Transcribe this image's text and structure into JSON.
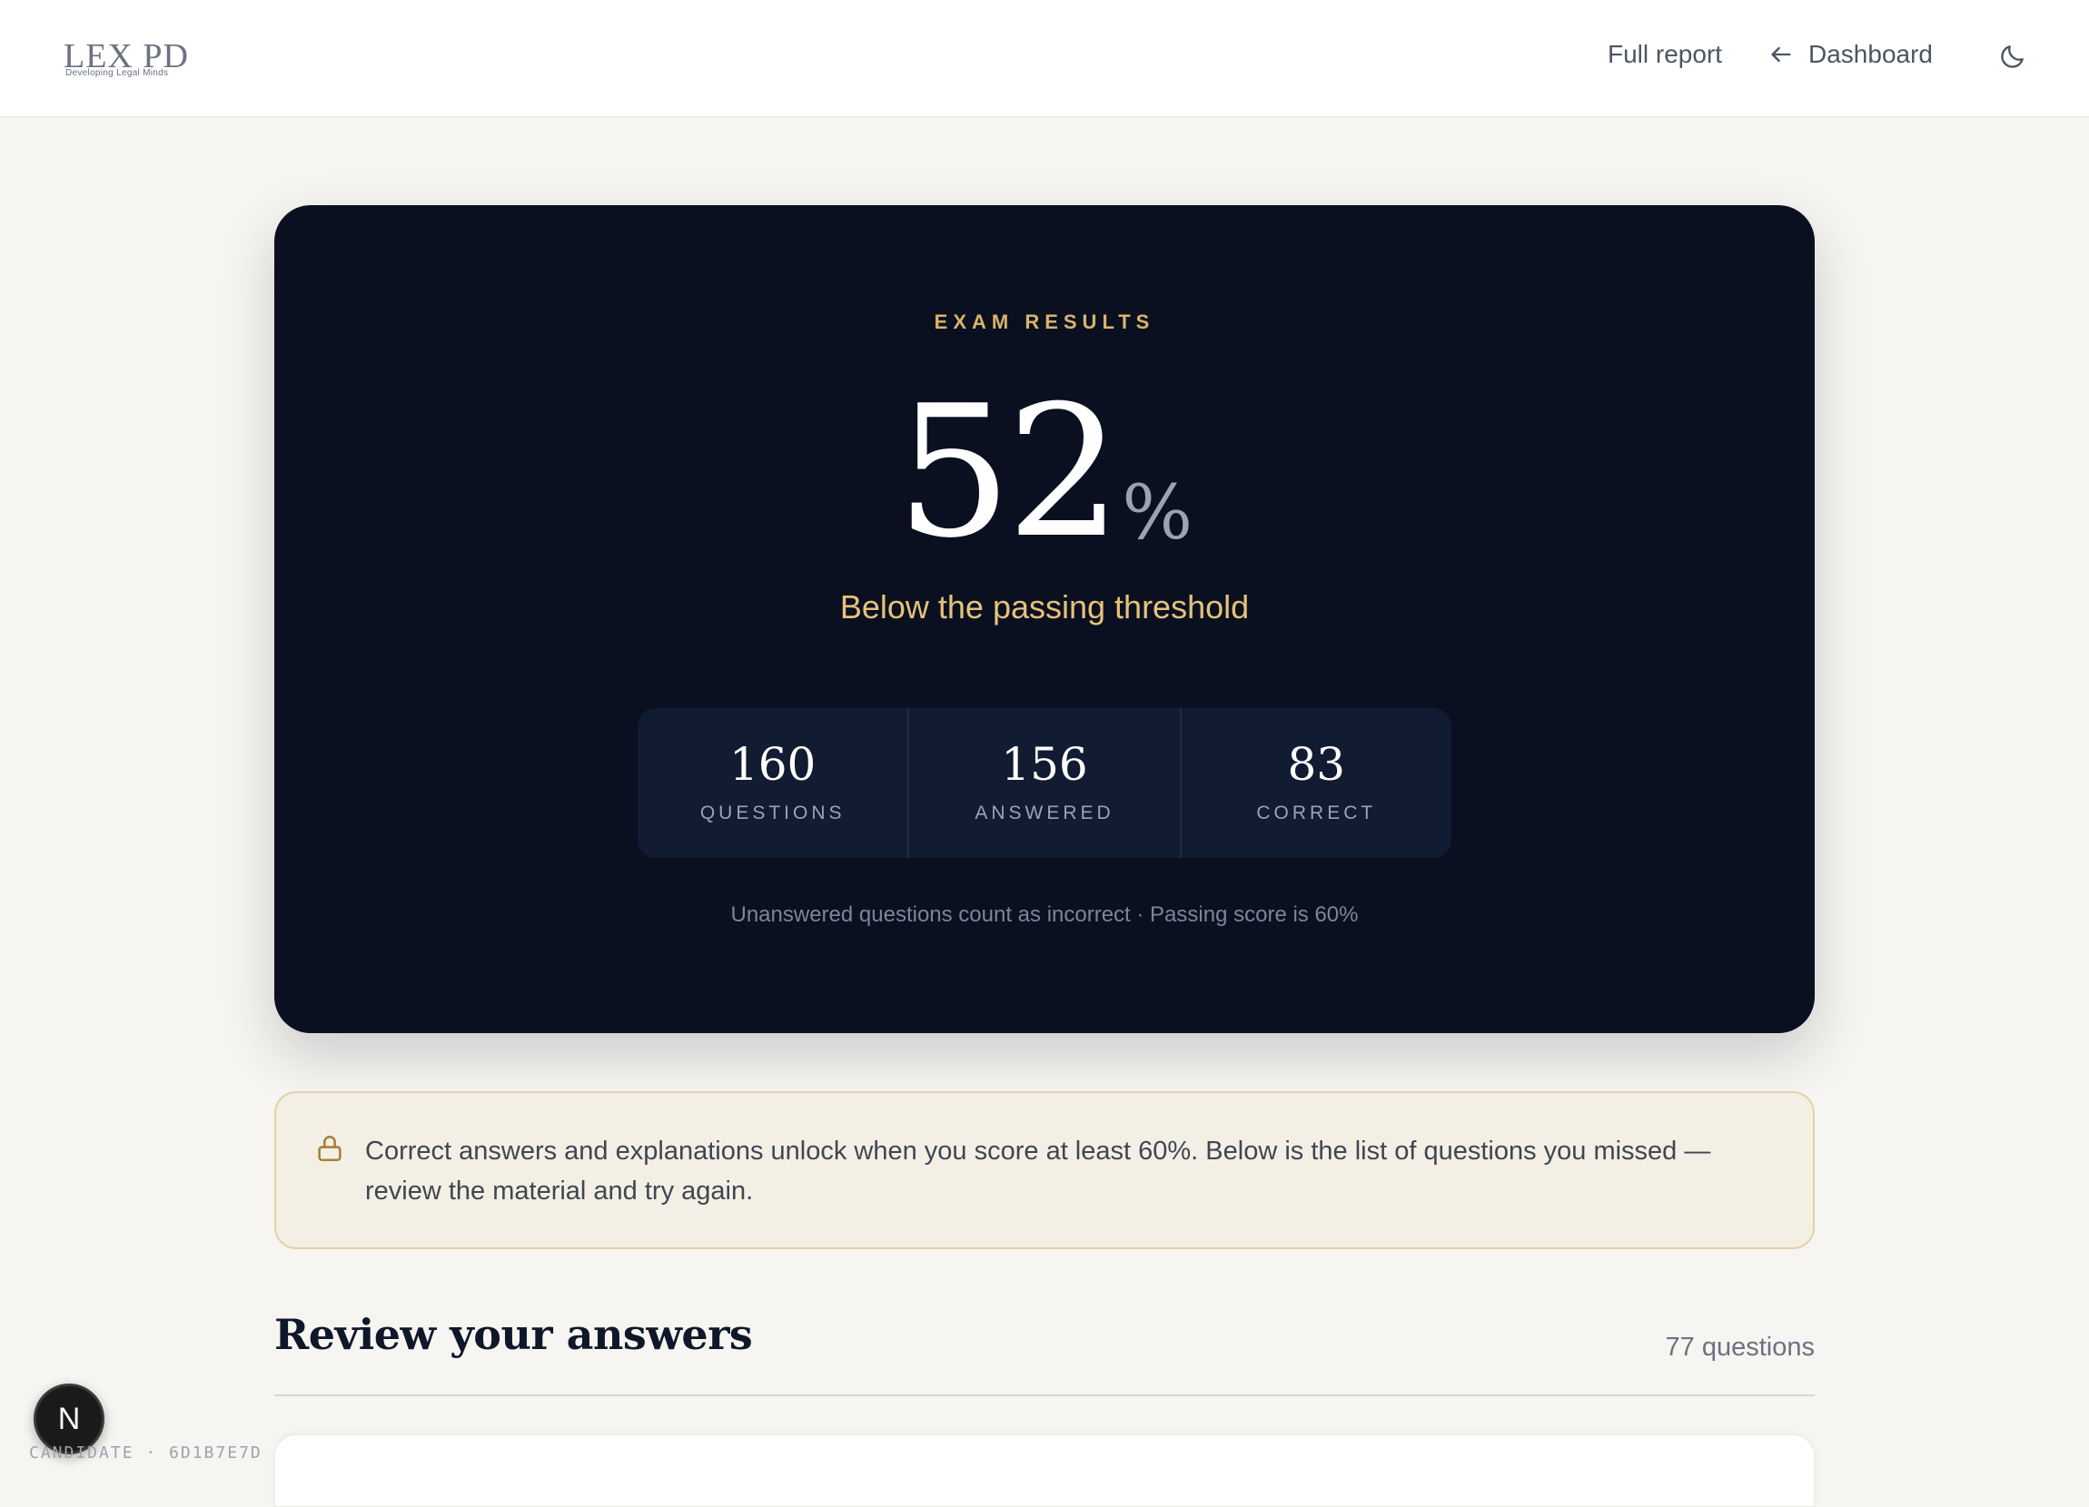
{
  "header": {
    "logo_text": "LEX PD",
    "logo_tagline": "Developing Legal Minds",
    "full_report_label": "Full report",
    "dashboard_label": "Dashboard",
    "theme_icon": "moon-icon",
    "back_icon": "arrow-left-icon"
  },
  "hero": {
    "eyebrow": "EXAM RESULTS",
    "score_value": "52",
    "score_unit": "%",
    "status": "Below the passing threshold",
    "stats": [
      {
        "value": "160",
        "label": "QUESTIONS"
      },
      {
        "value": "156",
        "label": "ANSWERED"
      },
      {
        "value": "83",
        "label": "CORRECT"
      }
    ],
    "footnote": "Unanswered questions count as incorrect · Passing score is 60%"
  },
  "notice": {
    "icon": "lock-icon",
    "text": "Correct answers and explanations unlock when you score at least 60%. Below is the list of questions you missed — review the material and try again."
  },
  "review": {
    "title": "Review your answers",
    "count": "77 questions"
  },
  "badge": {
    "letter": "N",
    "candidate": "CANDIDATE · 6D1B7E7D"
  },
  "colors": {
    "hero_bg": "#0a1020",
    "accent_gold": "#d9b46a",
    "page_bg": "#f6f5f1",
    "notice_bg": "#f4efe4"
  }
}
